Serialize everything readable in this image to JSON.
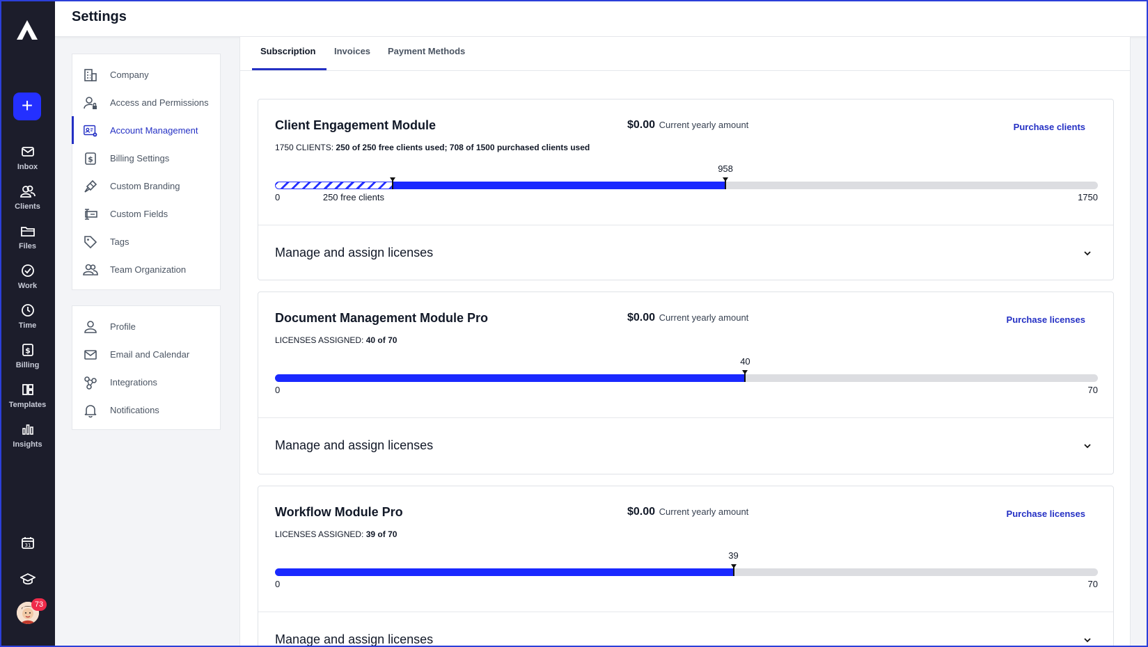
{
  "header": {
    "title": "Settings"
  },
  "rail": {
    "add_label": "+",
    "items": [
      {
        "label": "Inbox",
        "icon": "mail-icon"
      },
      {
        "label": "Clients",
        "icon": "users-icon"
      },
      {
        "label": "Files",
        "icon": "folder-icon"
      },
      {
        "label": "Work",
        "icon": "check-circle-icon"
      },
      {
        "label": "Time",
        "icon": "clock-icon"
      },
      {
        "label": "Billing",
        "icon": "dollar-icon"
      },
      {
        "label": "Templates",
        "icon": "templates-icon"
      },
      {
        "label": "Insights",
        "icon": "bar-chart-icon"
      }
    ],
    "notification_count": "73"
  },
  "nav": {
    "group1": [
      {
        "label": "Company",
        "icon": "building-icon"
      },
      {
        "label": "Access and Permissions",
        "icon": "user-lock-icon"
      },
      {
        "label": "Account Management",
        "icon": "account-gear-icon",
        "active": true
      },
      {
        "label": "Billing Settings",
        "icon": "dollar-doc-icon"
      },
      {
        "label": "Custom Branding",
        "icon": "brush-icon"
      },
      {
        "label": "Custom Fields",
        "icon": "field-icon"
      },
      {
        "label": "Tags",
        "icon": "tag-icon"
      },
      {
        "label": "Team Organization",
        "icon": "team-icon"
      }
    ],
    "group2": [
      {
        "label": "Profile",
        "icon": "user-icon"
      },
      {
        "label": "Email and Calendar",
        "icon": "mail-icon"
      },
      {
        "label": "Integrations",
        "icon": "integrations-icon"
      },
      {
        "label": "Notifications",
        "icon": "bell-icon"
      }
    ]
  },
  "tabs": [
    {
      "label": "Subscription",
      "active": true
    },
    {
      "label": "Invoices"
    },
    {
      "label": "Payment Methods"
    }
  ],
  "amount_suffix": "Current yearly amount",
  "manage_label": "Manage and assign licenses",
  "modules": [
    {
      "title": "Client Engagement Module",
      "amount": "$0.00",
      "purchase_label": "Purchase clients",
      "sub_prefix": "1750 CLIENTS:",
      "sub_value": "250 of 250 free clients used; 708 of 1500 purchased clients used",
      "min": "0",
      "max": "1750",
      "free": 250,
      "free_label": "250 free clients",
      "used": 958,
      "used_label": "958",
      "total": 1750
    },
    {
      "title": "Document Management Module Pro",
      "amount": "$0.00",
      "purchase_label": "Purchase licenses",
      "sub_prefix": "LICENSES ASSIGNED:",
      "sub_value": "40 of 70",
      "min": "0",
      "max": "70",
      "used": 40,
      "used_label": "40",
      "total": 70
    },
    {
      "title": "Workflow Module Pro",
      "amount": "$0.00",
      "purchase_label": "Purchase licenses",
      "sub_prefix": "LICENSES ASSIGNED:",
      "sub_value": "39 of 70",
      "min": "0",
      "max": "70",
      "used": 39,
      "used_label": "39",
      "total": 70
    }
  ]
}
